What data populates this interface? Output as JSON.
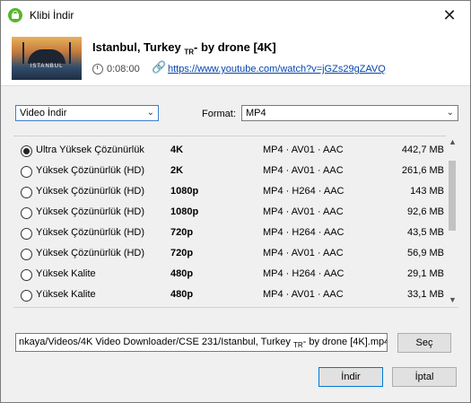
{
  "window": {
    "title": "Klibi İndir",
    "close": "✕"
  },
  "video": {
    "title_main": "Istanbul, Turkey ",
    "title_sub": "TR",
    "title_rest": "- by drone [4K]",
    "thumbnail_caption": "ISTANBUL",
    "duration": "0:08:00",
    "url": "https://www.youtube.com/watch?v=jGZs29gZAVQ"
  },
  "controls": {
    "mode_value": "Video İndir",
    "format_label": "Format:",
    "format_value": "MP4"
  },
  "qualities": [
    {
      "label": "Ultra Yüksek Çözünürlük",
      "res": "4K",
      "codec": "MP4 · AV01 · AAC",
      "size": "442,7 MB",
      "checked": true
    },
    {
      "label": "Yüksek Çözünürlük (HD)",
      "res": "2K",
      "codec": "MP4 · AV01 · AAC",
      "size": "261,6 MB",
      "checked": false
    },
    {
      "label": "Yüksek Çözünürlük (HD)",
      "res": "1080p",
      "codec": "MP4 · H264 · AAC",
      "size": "143 MB",
      "checked": false
    },
    {
      "label": "Yüksek Çözünürlük (HD)",
      "res": "1080p",
      "codec": "MP4 · AV01 · AAC",
      "size": "92,6 MB",
      "checked": false
    },
    {
      "label": "Yüksek Çözünürlük (HD)",
      "res": "720p",
      "codec": "MP4 · H264 · AAC",
      "size": "43,5 MB",
      "checked": false
    },
    {
      "label": "Yüksek Çözünürlük (HD)",
      "res": "720p",
      "codec": "MP4 · AV01 · AAC",
      "size": "56,9 MB",
      "checked": false
    },
    {
      "label": "Yüksek Kalite",
      "res": "480p",
      "codec": "MP4 · H264 · AAC",
      "size": "29,1 MB",
      "checked": false
    },
    {
      "label": "Yüksek Kalite",
      "res": "480p",
      "codec": "MP4 · AV01 · AAC",
      "size": "33,1 MB",
      "checked": false
    }
  ],
  "path": {
    "value_main": "nkaya/Videos/4K Video Downloader/CSE 231/Istanbul, Turkey ",
    "value_sub": "TR",
    "value_rest": "- by drone [4K].mp4",
    "browse_label": "Seç"
  },
  "actions": {
    "download_label": "İndir",
    "cancel_label": "İptal"
  },
  "colors": {
    "accent": "#0078d7",
    "link": "#0645ad",
    "app_icon": "#5ab52f"
  }
}
